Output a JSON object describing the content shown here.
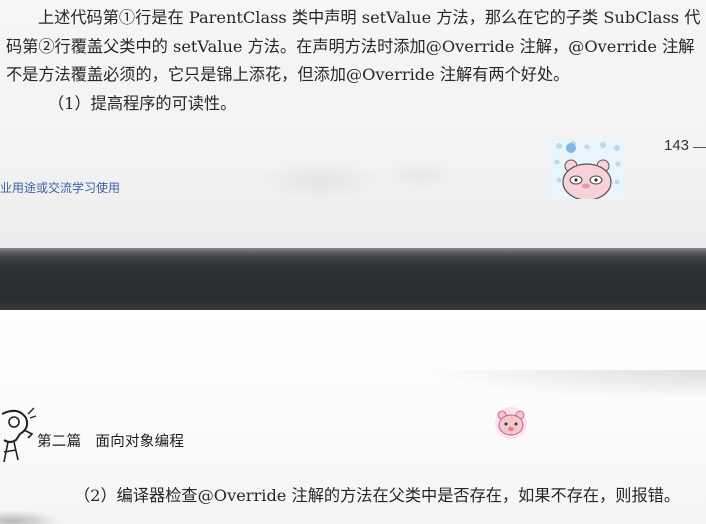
{
  "top_page": {
    "paragraph_lines": [
      "上述代码第①行是在 ParentClass 类中声明 setValue 方法，那么在它的子类 SubClass 代",
      "码第②行覆盖父类中的 setValue 方法。在声明方法时添加@Override 注解，@Override 注解",
      "不是方法覆盖必须的，它只是锦上添花，但添加@Override 注解有两个好处。",
      "（1）提高程序的可读性。"
    ],
    "page_number": "143",
    "watermark": "业用途或交流学习使用"
  },
  "bottom_page": {
    "part_label": "第二篇",
    "part_title": "面向对象编程",
    "paragraph": "（2）编译器检查@Override 注解的方法在父类中是否存在，如果不存在，则报错。"
  },
  "icons": {
    "sticker_top": "cartoon-bear-sticker",
    "sticker_bottom": "pink-bear-sticker",
    "header_icon": "person-thinking-icon"
  },
  "colors": {
    "watermark": "#3a5fa8",
    "separator": "#2b2e31",
    "sticker_bg": "#e9f4fb",
    "bear_pink": "#f4c7cf"
  }
}
